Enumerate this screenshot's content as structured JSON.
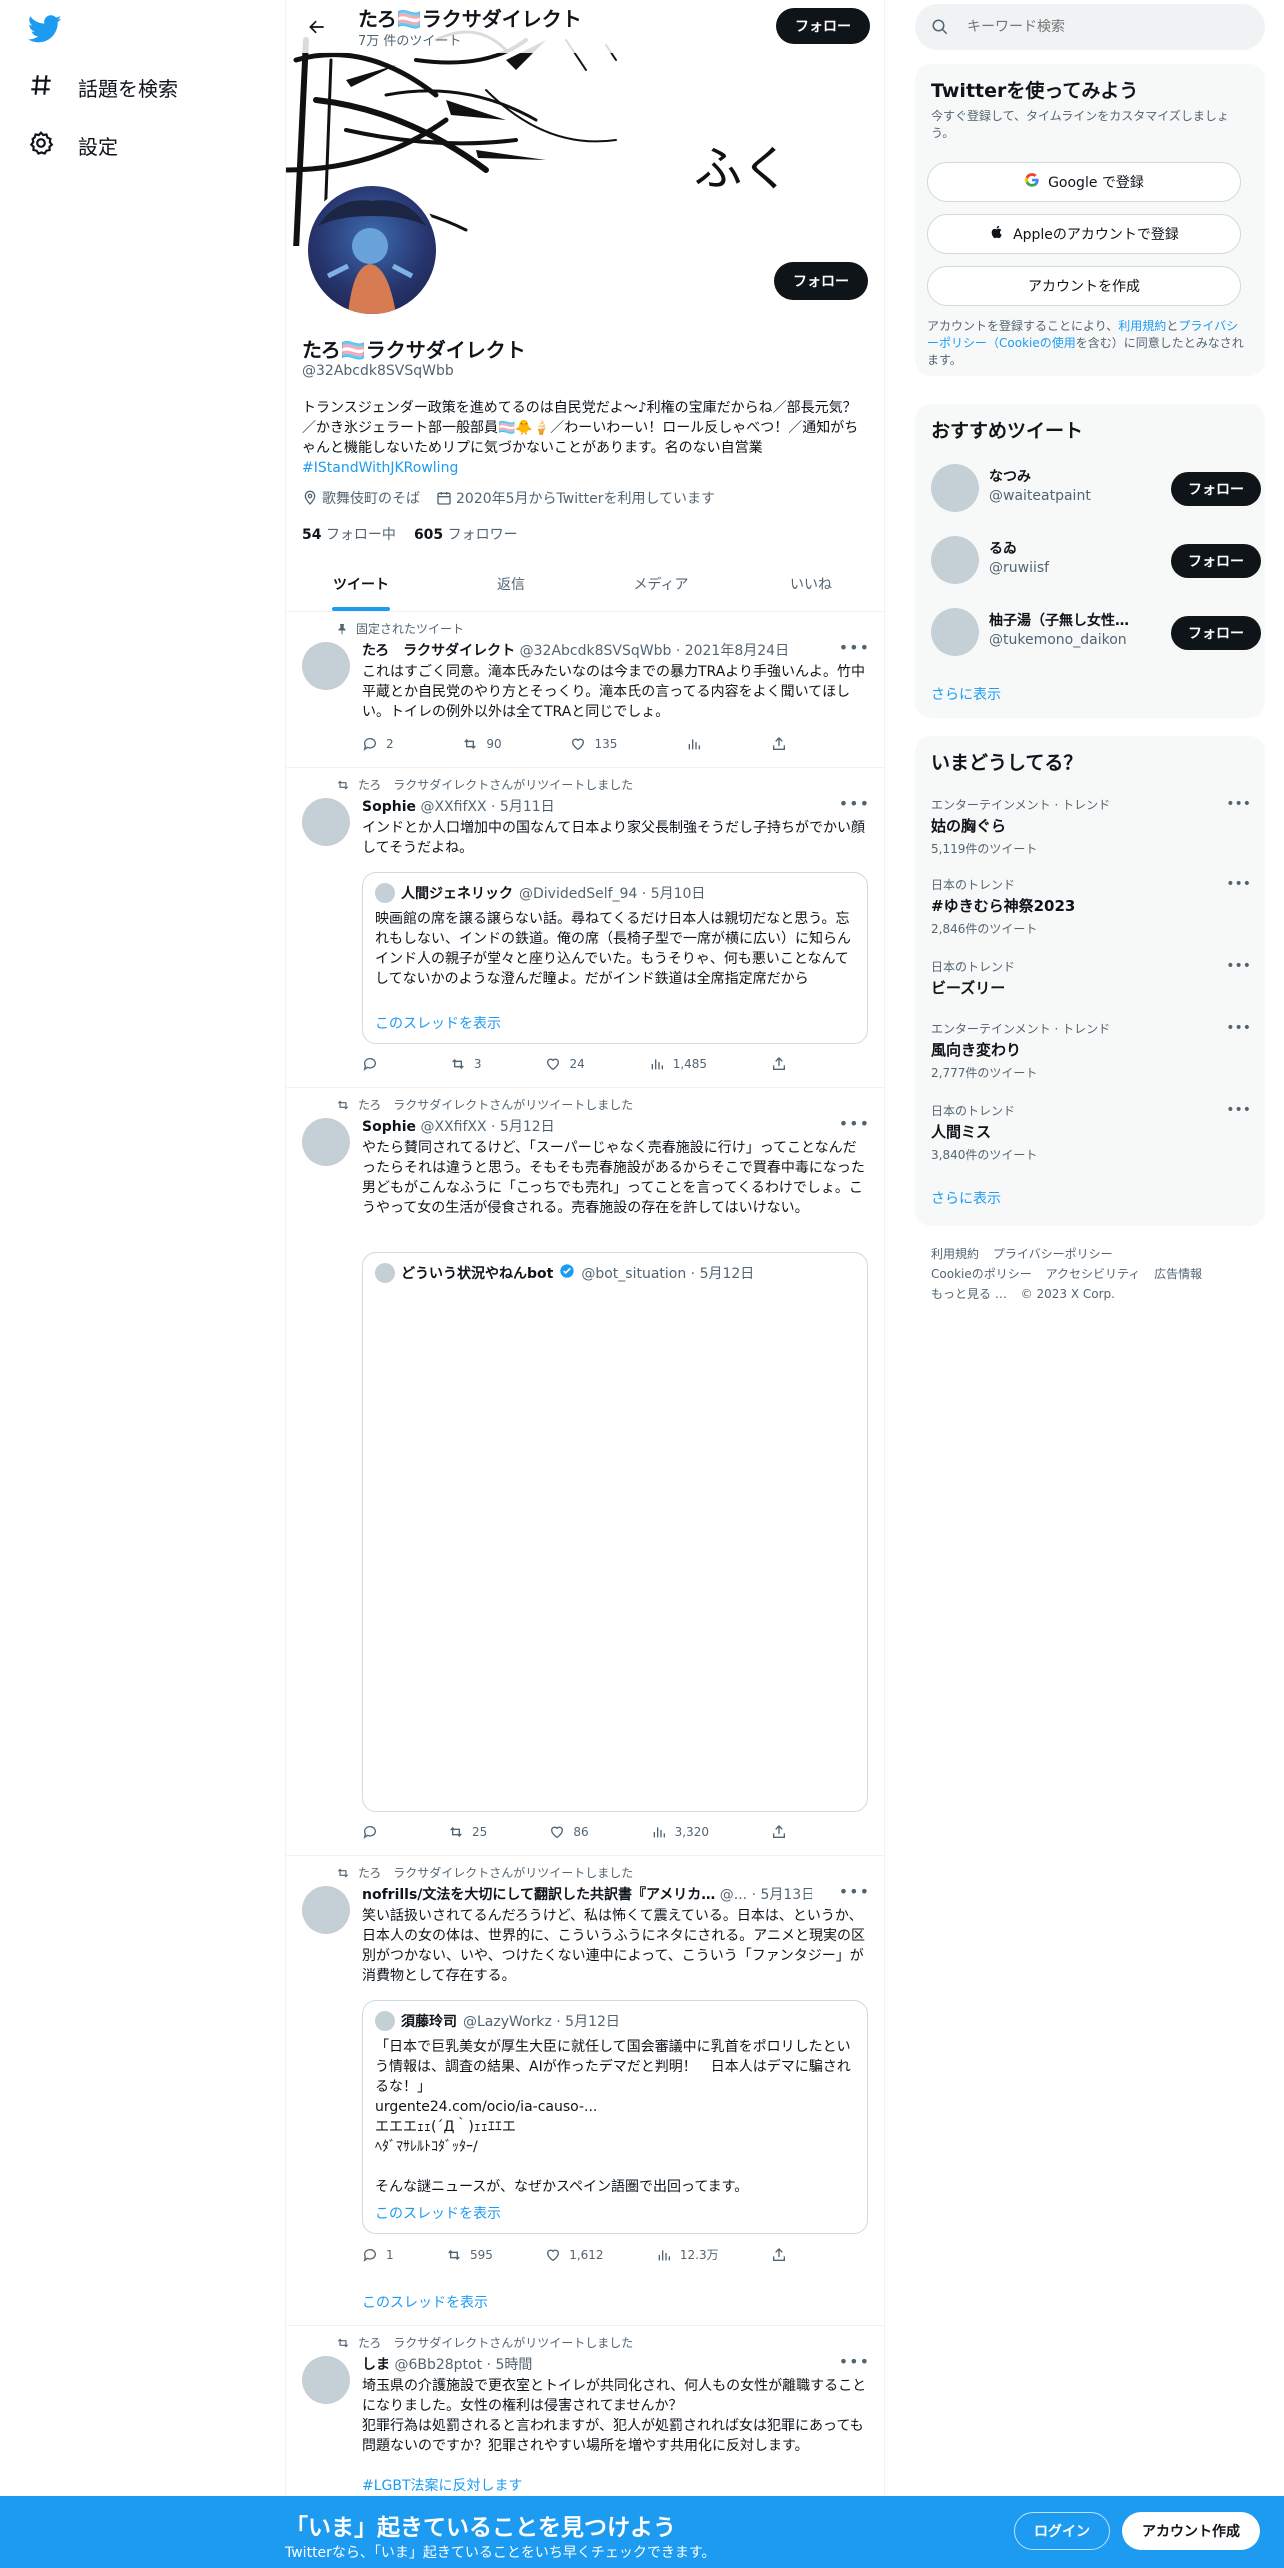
{
  "nav": {
    "explore_label": "話題を検索",
    "settings_label": "設定"
  },
  "topbar": {
    "name": "たろ🏳️‍⚧️ラクサダイレクト",
    "tweet_count": "7万 件のツイート",
    "follow_label": "フォロー"
  },
  "banner": {
    "calligraphy": "ふく"
  },
  "profile": {
    "name": "たろ🏳️‍⚧️ラクサダイレクト",
    "handle": "@32Abcdk8SVSqWbb",
    "bio": "トランスジェンダー政策を進めてるのは自民党だよ〜♪利権の宝庫だからね／部長元気？／かき氷ジェラート部一般部員🏳️‍⚧️🐥🍦／わーいわーい！ロール反しゃべつ！／通知がちゃんと機能しないためリプに気づかないことがあります。名のない自営業",
    "bio_hashtag": "#IStandWithJKRowling",
    "location": "歌舞伎町のそば",
    "joined": "2020年5月からTwitterを利用しています",
    "following_count": "54",
    "following_label": "フォロー中",
    "followers_count": "605",
    "followers_label": "フォロワー",
    "follow_label": "フォロー"
  },
  "tabs": [
    "ツイート",
    "返信",
    "メディア",
    "いいね"
  ],
  "tweets": [
    {
      "social": "固定されたツイート",
      "name": "たろ　ラクサダイレクト",
      "handle": "@32Abcdk8SVSqWbb",
      "date": "· 2021年8月24日",
      "text": "これはすごく同意。滝本氏みたいなのは今までの暴力TRAより手強いんよ。竹中平蔵とか自民党のやり方とそっくり。滝本氏の言ってる内容をよく聞いてほしい。トイレの例外以外は全てTRAと同じでしょ。",
      "replies": "2",
      "retweets": "90",
      "likes": "135",
      "views": ""
    },
    {
      "social": "たろ　ラクサダイレクトさんがリツイートしました",
      "name": "Sophie",
      "handle": "@XXfifXX",
      "date": "· 5月11日",
      "text": "インドとか人口増加中の国なんて日本より家父長制強そうだし子持ちがでかい顔してそうだよね。",
      "quote_name": "人間ジェネリック",
      "quote_handle": "@DividedSelf_94 · 5月10日",
      "quote_text": "映画館の席を譲る譲らない話。尋ねてくるだけ日本人は親切だなと思う。忘れもしない、インドの鉄道。俺の席（長椅子型で一席が横に広い）に知らんインド人の親子が堂々と座り込んでいた。もうそりゃ、何も悪いことなんてしてないかのような澄んだ瞳よ。だがインド鉄道は全席指定席だから",
      "quote_show": "このスレッドを表示",
      "replies": "",
      "retweets": "3",
      "likes": "24",
      "views": "1,485"
    },
    {
      "social": "たろ　ラクサダイレクトさんがリツイートしました",
      "name": "Sophie",
      "handle": "@XXfifXX",
      "date": "· 5月12日",
      "text": "やたら賛同されてるけど、「スーパーじゃなく売春施設に行け」ってことなんだったらそれは違うと思う。そもそも売春施設があるからそこで買春中毒になった男どもがこんなふうに「こっちでも売れ」ってことを言ってくるわけでしょ。こうやって女の生活が侵食される。売春施設の存在を許してはいけない。",
      "quote_name": "どういう状況やねんbot",
      "quote_handle": "@bot_situation · 5月12日",
      "replies": "",
      "retweets": "25",
      "likes": "86",
      "views": "3,320"
    },
    {
      "social": "たろ　ラクサダイレクトさんがリツイートしました",
      "name": "nofrills/文法を大切にして翻訳した共訳書『アメリカ…",
      "handle": "@...",
      "date": "· 5月13日",
      "text": "笑い話扱いされてるんだろうけど、私は怖くて震えている。日本は、というか、日本人の女の体は、世界的に、こういうふうにネタにされる。アニメと現実の区別がつかない、いや、つけたくない連中によって、こういう「ファンタジー」が消費物として存在する。",
      "quote_name": "須藤玲司",
      "quote_handle": "@LazyWorkz · 5月12日",
      "quote_text": "「日本で巨乳美女が厚生大臣に就任して国会審議中に乳首をポロリしたという情報は、調査の結果、AIが作ったデマだと判明！　日本人はデマに騙されるな！」",
      "quote_link": "urgente24.com/ocio/ia-causo-...",
      "quote_ascii1": "エエエｪｪ(´Д｀)ｪｪｴｴエ",
      "quote_ascii2": "ﾍﾀﾞﾏｻﾚﾙﾄｺﾀﾞｯﾀｰ/",
      "quote_text2": "そんな謎ニュースが、なぜかスペイン語圏で出回ってます。",
      "quote_show": "このスレッドを表示",
      "show_thread": "このスレッドを表示",
      "replies": "1",
      "retweets": "595",
      "likes": "1,612",
      "views": "12.3万"
    },
    {
      "social": "たろ　ラクサダイレクトさんがリツイートしました",
      "name": "しま",
      "handle": "@6Bb28ptot",
      "date": "· 5時間",
      "text": "埼玉県の介護施設で更衣室とトイレが共同化され、何人もの女性が離職することになりました。女性の権利は侵害されてませんか？\n犯罪行為は処罰されると言われますが、犯人が処罰されれば女は犯罪にあっても問題ないのですか？犯罪されやすい場所を増やす共用化に反対します。",
      "hashtag": "#LGBT法案に反対します"
    }
  ],
  "right": {
    "search_placeholder": "キーワード検索",
    "signup": {
      "title": "Twitterを使ってみよう",
      "subtitle": "今すぐ登録して、タイムラインをカスタマイズしましょう。",
      "google": "Google で登録",
      "apple": "Appleのアカウントで登録",
      "create": "アカウントを作成",
      "legal_1": "アカウントを登録することにより、",
      "legal_terms": "利用規約",
      "legal_2": "と",
      "legal_privacy": "プライバシーポリシー（Cookieの使用",
      "legal_3": "を含む）に同意したとみなされます。"
    },
    "recommend": {
      "title": "おすすめツイート",
      "users": [
        {
          "name": "なつみ",
          "handle": "@waiteatpaint"
        },
        {
          "name": "るゐ",
          "handle": "@ruwiisf"
        },
        {
          "name": "柚子湯（子無し女性…",
          "handle": "@tukemono_daikon"
        }
      ],
      "follow_label": "フォロー",
      "more": "さらに表示"
    },
    "trends": {
      "title": "いまどうしてる？",
      "items": [
        {
          "cat": "エンターテインメント · トレンド",
          "name": "姑の胸ぐら",
          "count": "5,119件のツイート"
        },
        {
          "cat": "日本のトレンド",
          "name": "#ゆきむら神祭2023",
          "count": "2,846件のツイート"
        },
        {
          "cat": "日本のトレンド",
          "name": "ビーズリー",
          "count": ""
        },
        {
          "cat": "エンターテインメント · トレンド",
          "name": "風向き変わり",
          "count": "2,777件のツイート"
        },
        {
          "cat": "日本のトレンド",
          "name": "人間ミス",
          "count": "3,840件のツイート"
        }
      ],
      "more": "さらに表示"
    },
    "footer": {
      "terms": "利用規約",
      "privacy": "プライバシーポリシー",
      "cookie": "Cookieのポリシー",
      "access": "アクセシビリティ",
      "ads": "広告情報",
      "more": "もっと見る …",
      "copy": "© 2023 X Corp."
    }
  },
  "bottombar": {
    "title": "「いま」起きていることを見つけよう",
    "subtitle": "Twitterなら、「いま」起きていることをいち早くチェックできます。",
    "login": "ログイン",
    "signup": "アカウント作成"
  },
  "colors": {
    "accent": "#1d9bf0",
    "text": "#0f1419",
    "muted": "#536471"
  }
}
